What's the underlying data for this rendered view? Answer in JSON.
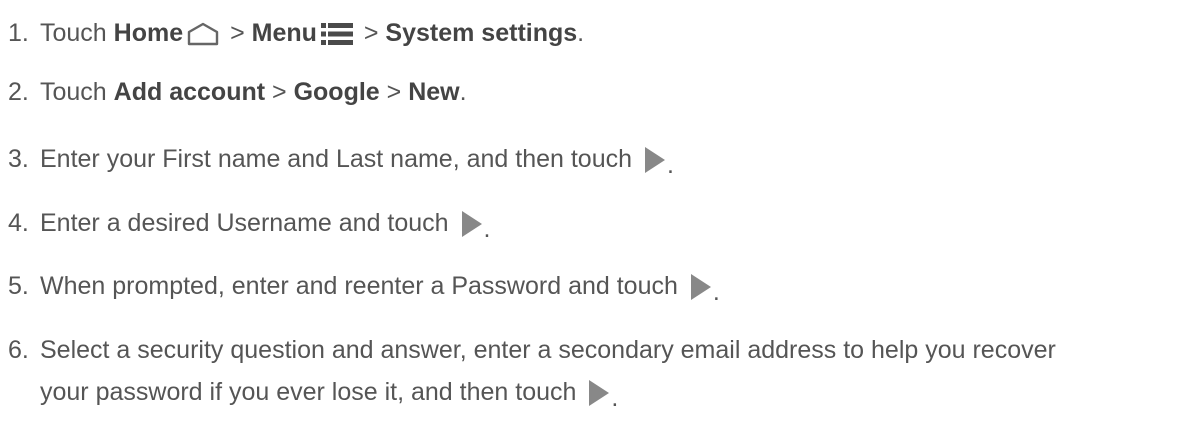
{
  "steps": [
    {
      "num": "1.",
      "parts": {
        "a": "Touch ",
        "home": "Home",
        "b": " > ",
        "menu": "Menu",
        "c": " > ",
        "settings": "System settings",
        "d": "."
      }
    },
    {
      "num": "2.",
      "parts": {
        "a": "Touch ",
        "add": "Add account",
        "b": " > ",
        "google": "Google",
        "c": " > ",
        "new": "New",
        "d": "."
      }
    },
    {
      "num": "3.",
      "text": "Enter your First name and Last name, and then touch ",
      "end": "."
    },
    {
      "num": "4.",
      "text": "Enter a desired Username and touch ",
      "end": "."
    },
    {
      "num": "5.",
      "text": "When prompted, enter and reenter a Password and touch ",
      "end": "."
    },
    {
      "num": "6.",
      "text": "Select a security question and answer, enter a secondary email address to help you recover",
      "text2": "your password if you ever lose it, and then touch ",
      "end": "."
    }
  ],
  "icons": {
    "home": "home-icon",
    "menu": "menu-icon",
    "next": "next-arrow-icon"
  },
  "colors": {
    "text": "#555555",
    "icon": "#888888"
  }
}
